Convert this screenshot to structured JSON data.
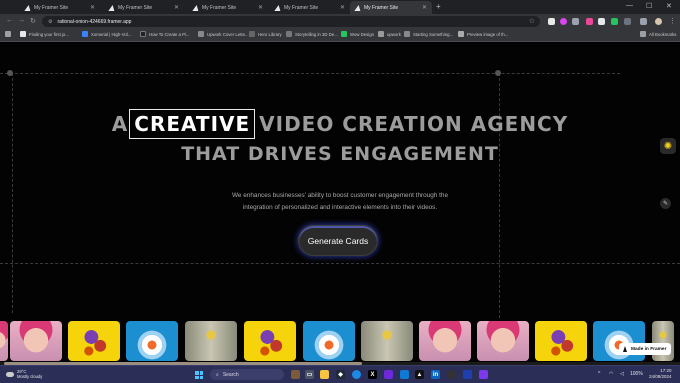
{
  "browser": {
    "tabs": [
      {
        "label": "My Framer Site",
        "active": false
      },
      {
        "label": "My Framer Site",
        "active": false
      },
      {
        "label": "My Framer Site",
        "active": false
      },
      {
        "label": "My Framer Site",
        "active": false
      },
      {
        "label": "My Framer Site",
        "active": true
      }
    ],
    "url": "rational-onion-424669.framer.app",
    "bookmarks": [
      {
        "label": "Finding your first jo...",
        "icon_color": "#e8e8e8"
      },
      {
        "label": "Xomerial | High-Vol...",
        "icon_color": "#3b82f6"
      },
      {
        "label": "How To Create a Pi...",
        "icon_color": "#222222"
      },
      {
        "label": "Upwork Cover Lette...",
        "icon_color": "#888888"
      },
      {
        "label": "Hero Library",
        "icon_color": "#666666"
      },
      {
        "label": "Storytelling in 3D De...",
        "icon_color": "#777777"
      },
      {
        "label": "Wow Design",
        "icon_color": "#22c55e"
      },
      {
        "label": "upwork",
        "icon_color": "#999999"
      },
      {
        "label": "Starting Something...",
        "icon_color": "#888888"
      },
      {
        "label": "Preview image of th...",
        "icon_color": "#aaaaaa"
      }
    ],
    "all_bookmarks_label": "All Bookmarks"
  },
  "hero": {
    "headline_prefix": "A",
    "headline_highlight": "CREATIVE",
    "headline_suffix": "VIDEO CREATION AGENCY",
    "headline_line2": "THAT DRIVES ENGAGEMENT",
    "subtext_line1": "We enhances businesses' ability to boost customer engagement through the",
    "subtext_line2": "integration of personalized and interactive elements into their videos.",
    "cta_label": "Generate Cards"
  },
  "cards": [
    "face",
    "dancer",
    "flower",
    "statue",
    "dancer",
    "flower",
    "statue",
    "face",
    "face",
    "dancer",
    "flower",
    "statue"
  ],
  "made_in_framer_label": "Made in Framer",
  "taskbar": {
    "weather_temp": "29°C",
    "weather_desc": "Mostly cloudy",
    "search_placeholder": "Search",
    "tray_language": "ENG",
    "battery": "100%",
    "time": "17:20",
    "date": "24/08/2024"
  },
  "colors": {
    "page_bg": "#030303",
    "taskbar_bg": "#2b2e57",
    "cta_glow": "#4650ff"
  }
}
